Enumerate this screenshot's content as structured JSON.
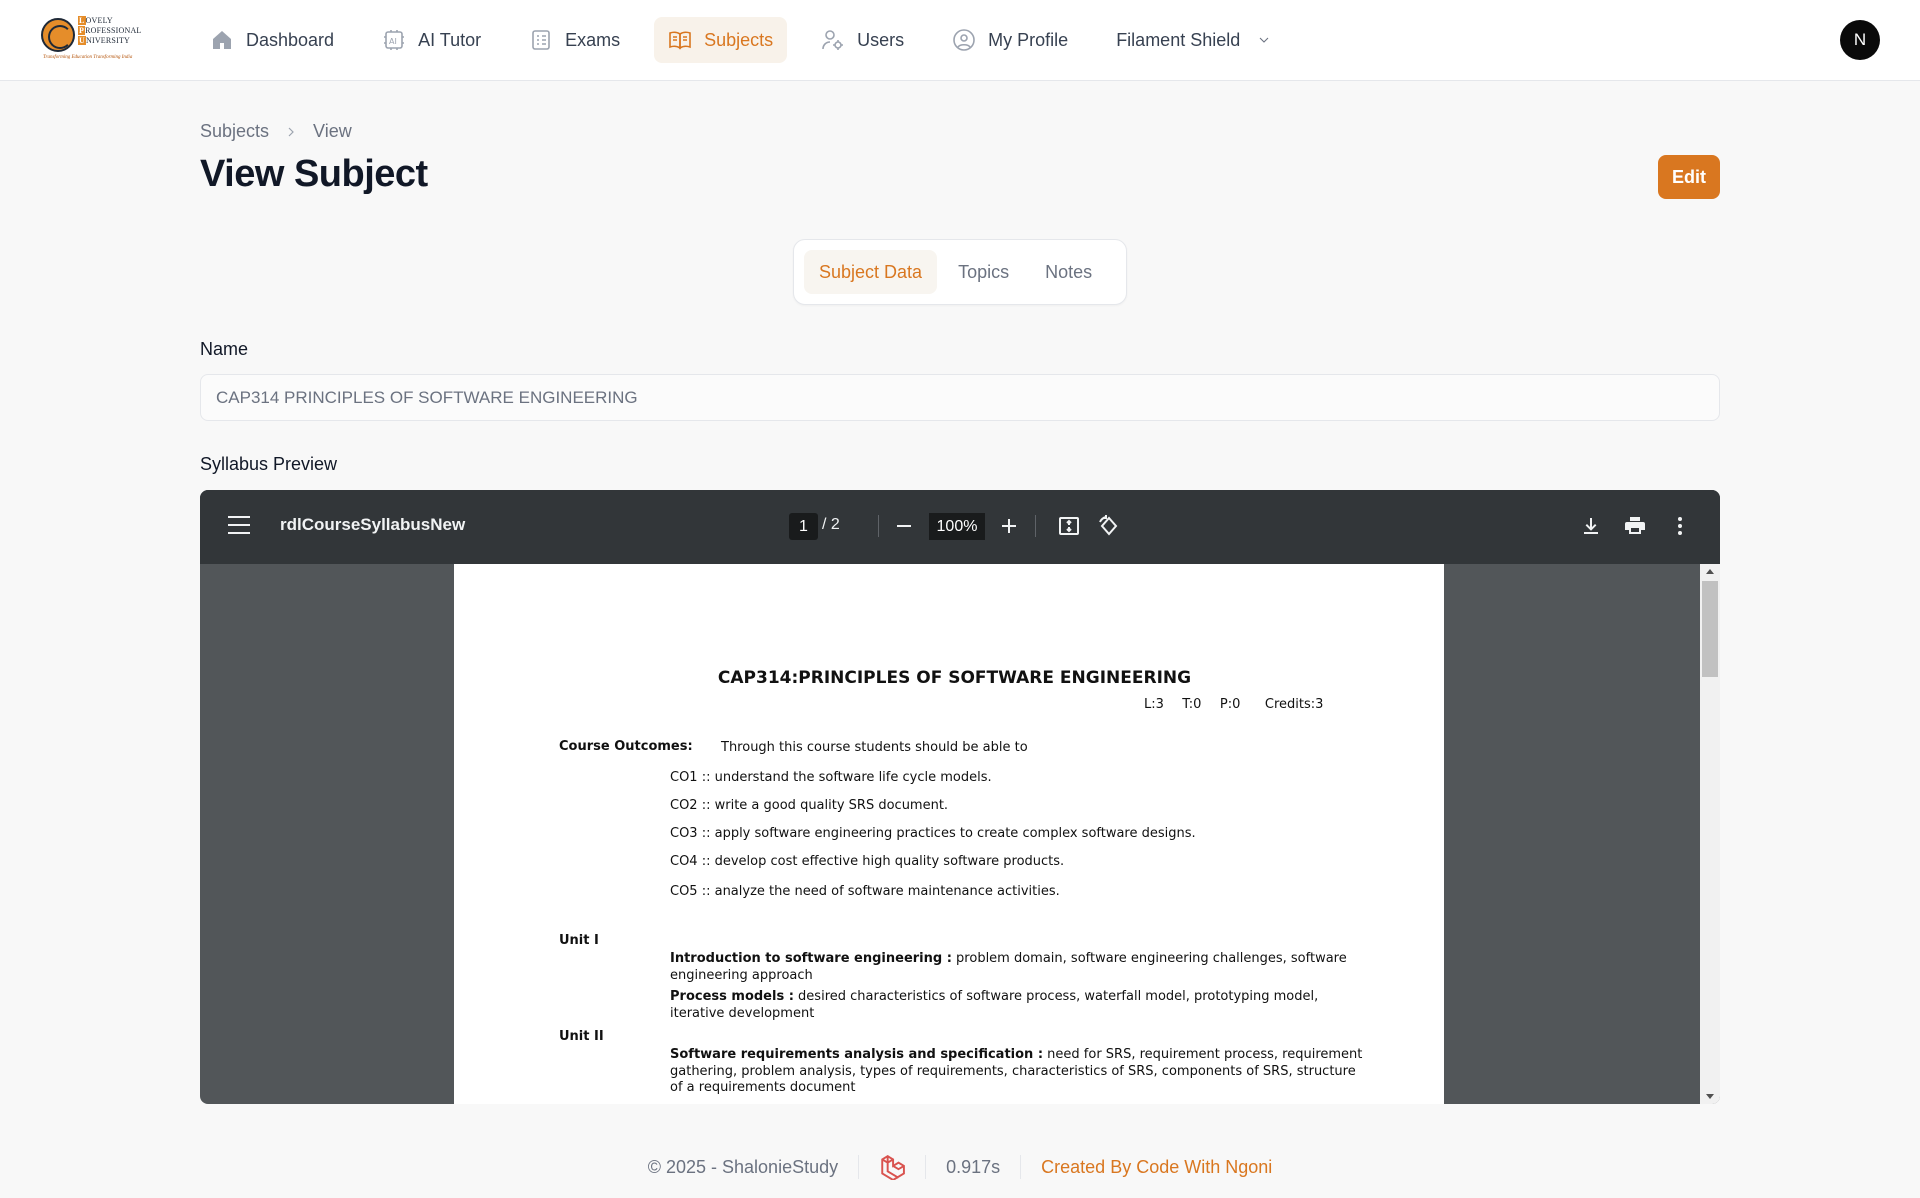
{
  "brand": {
    "logo_letters": [
      "OVELY",
      "ROFESSIONAL",
      "NIVERSITY"
    ],
    "logo_initials": [
      "L",
      "P",
      "U"
    ],
    "logo_tagline": "Transforming Education Transforming India"
  },
  "nav": {
    "items": [
      {
        "label": "Dashboard",
        "icon": "home-icon"
      },
      {
        "label": "AI Tutor",
        "icon": "ai-icon"
      },
      {
        "label": "Exams",
        "icon": "exam-icon"
      },
      {
        "label": "Subjects",
        "icon": "book-open-icon",
        "active": true
      },
      {
        "label": "Users",
        "icon": "users-gear-icon"
      },
      {
        "label": "My Profile",
        "icon": "user-circle-icon"
      },
      {
        "label": "Filament Shield",
        "icon": "chevron-down-icon"
      }
    ],
    "avatar_initial": "N"
  },
  "header": {
    "breadcrumb": [
      "Subjects",
      "View"
    ],
    "title": "View Subject",
    "edit_label": "Edit"
  },
  "tabs": [
    {
      "label": "Subject Data",
      "active": true
    },
    {
      "label": "Topics"
    },
    {
      "label": "Notes"
    }
  ],
  "form": {
    "name_label": "Name",
    "name_value": "CAP314 PRINCIPLES OF SOFTWARE ENGINEERING",
    "syllabus_label": "Syllabus Preview"
  },
  "pdf": {
    "file_name": "rdlCourseSyllabusNew",
    "current_page": "1",
    "page_of": "/  2",
    "zoom": "100%",
    "doc": {
      "title": "CAP314:PRINCIPLES OF SOFTWARE ENGINEERING",
      "credits": "L:3   T:0   P:0    Credits:3",
      "course_outcomes_label": "Course Outcomes:",
      "course_outcomes_intro": "Through this course students should be able to",
      "outcomes": [
        "CO1 :: understand the software life cycle models.",
        "CO2 :: write a good quality SRS document.",
        "CO3 :: apply software engineering practices to create complex software designs.",
        "CO4 :: develop cost effective high quality software products.",
        "CO5 :: analyze the need of software maintenance activities."
      ],
      "unit1": {
        "label": "Unit I",
        "p1_head": "Introduction to software engineering :",
        "p1_text": " problem domain, software engineering challenges, software engineering approach",
        "p2_head": "Process models :",
        "p2_text": " desired characteristics of software process, waterfall model, prototyping model, iterative development"
      },
      "unit2": {
        "label": "Unit II",
        "p1_head": "Software requirements analysis and specification :",
        "p1_text": " need for SRS, requirement process, requirement gathering, problem analysis, types of requirements, characteristics of SRS, components of SRS, structure of a requirements document"
      }
    }
  },
  "footer": {
    "copyright": "© 2025 - ShalonieStudy",
    "time": "0.917s",
    "credit": "Created By Code With Ngoni"
  }
}
